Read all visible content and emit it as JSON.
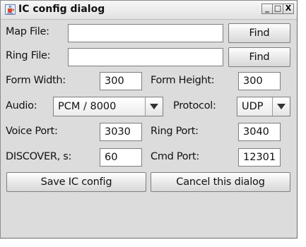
{
  "window": {
    "title": "IC config dialog",
    "controls": {
      "minimize": "_",
      "maximize": "□",
      "close": "X"
    }
  },
  "labels": {
    "map_file": "Map File:",
    "ring_file": "Ring File:",
    "form_width": "Form Width:",
    "form_height": "Form Height:",
    "audio": "Audio:",
    "protocol": "Protocol:",
    "voice_port": "Voice Port:",
    "ring_port": "Ring Port:",
    "discover": "DISCOVER, s:",
    "cmd_port": "Cmd Port:"
  },
  "fields": {
    "map_file": "",
    "ring_file": "",
    "form_width": "300",
    "form_height": "300",
    "voice_port": "3030",
    "ring_port": "3040",
    "discover": "60",
    "cmd_port": "12301"
  },
  "combos": {
    "audio": "PCM  / 8000",
    "protocol": "UDP"
  },
  "buttons": {
    "find_map": "Find",
    "find_ring": "Find",
    "save": "Save IC config",
    "cancel": "Cancel this dialog"
  },
  "icons": {
    "app": "java-cup-icon",
    "dropdown": "triangle-down-icon"
  }
}
